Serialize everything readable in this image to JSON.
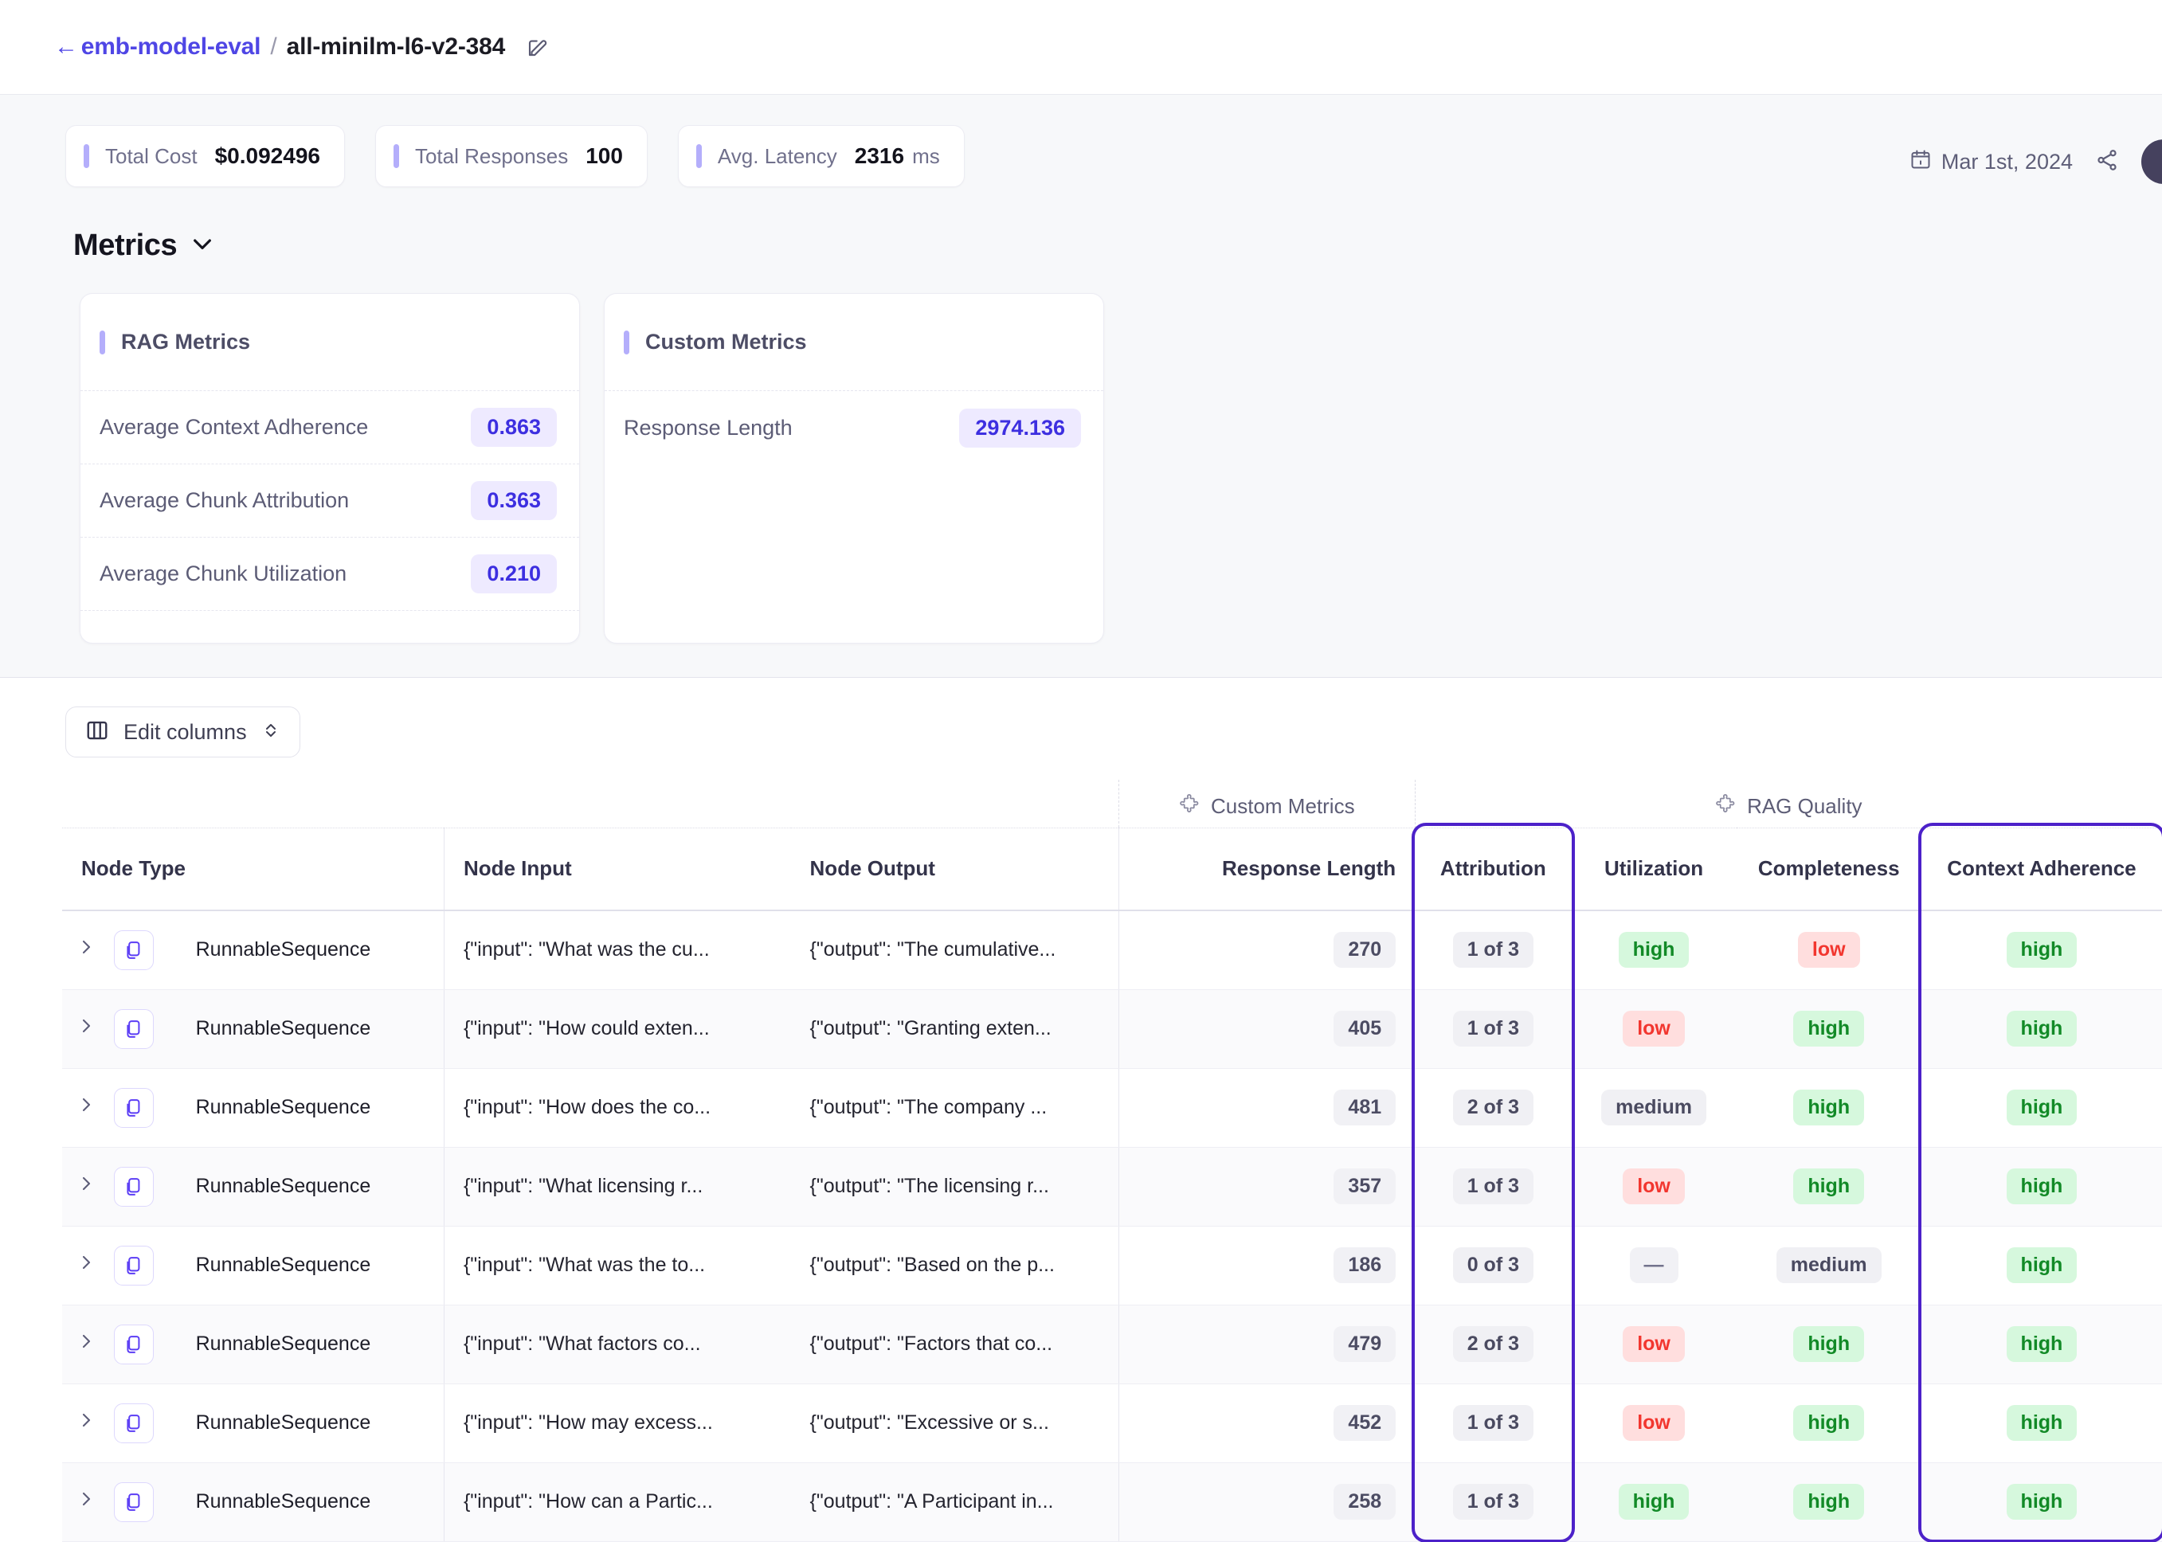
{
  "breadcrumb": {
    "back_arrow": "←",
    "parent": "emb-model-eval",
    "separator": "/",
    "current": "all-minilm-l6-v2-384",
    "edit_icon": "edit-icon"
  },
  "stats": [
    {
      "label": "Total Cost",
      "value": "$0.092496",
      "unit": ""
    },
    {
      "label": "Total Responses",
      "value": "100",
      "unit": ""
    },
    {
      "label": "Avg. Latency",
      "value": "2316",
      "unit": "ms"
    }
  ],
  "meta": {
    "date": "Mar 1st, 2024",
    "calendar_icon": "calendar-icon",
    "share_icon": "share-nodes-icon",
    "avatar": "user-avatar"
  },
  "metrics_section": {
    "title": "Metrics",
    "chevron": "chevron-down-icon",
    "cards": [
      {
        "title": "RAG Metrics",
        "rows": [
          {
            "label": "Average Context Adherence",
            "value": "0.863"
          },
          {
            "label": "Average Chunk Attribution",
            "value": "0.363"
          },
          {
            "label": "Average Chunk Utilization",
            "value": "0.210"
          }
        ]
      },
      {
        "title": "Custom Metrics",
        "rows": [
          {
            "label": "Response Length",
            "value": "2974.136"
          }
        ]
      }
    ]
  },
  "toolbar": {
    "edit_columns_label": "Edit columns",
    "columns_icon": "columns-icon",
    "sort_icon": "chevron-up-down-icon"
  },
  "table": {
    "groups": [
      {
        "label": "Custom Metrics",
        "icon": "puzzle-piece-icon"
      },
      {
        "label": "RAG Quality",
        "icon": "puzzle-piece-icon"
      }
    ],
    "columns": [
      "Node Type",
      "Node Input",
      "Node Output",
      "Response Length",
      "Attribution",
      "Utilization",
      "Completeness",
      "Context Adherence"
    ],
    "expand_icon": "chevron-right-icon",
    "node_icon": "copy-node-icon",
    "rows": [
      {
        "node_type": "RunnableSequence",
        "node_input": "{\"input\": \"What was the cu...",
        "node_output": "{\"output\": \"The cumulative...",
        "response_length": "270",
        "attribution": "1 of 3",
        "utilization": "high",
        "utilization_kind": "high",
        "completeness": "low",
        "completeness_kind": "low",
        "context_adherence": "high",
        "context_adherence_kind": "high"
      },
      {
        "node_type": "RunnableSequence",
        "node_input": "{\"input\": \"How could exten...",
        "node_output": "{\"output\": \"Granting exten...",
        "response_length": "405",
        "attribution": "1 of 3",
        "utilization": "low",
        "utilization_kind": "low",
        "completeness": "high",
        "completeness_kind": "high",
        "context_adherence": "high",
        "context_adherence_kind": "high"
      },
      {
        "node_type": "RunnableSequence",
        "node_input": "{\"input\": \"How does the co...",
        "node_output": "{\"output\": \"The company ...",
        "response_length": "481",
        "attribution": "2 of 3",
        "utilization": "medium",
        "utilization_kind": "medium",
        "completeness": "high",
        "completeness_kind": "high",
        "context_adherence": "high",
        "context_adherence_kind": "high"
      },
      {
        "node_type": "RunnableSequence",
        "node_input": "{\"input\": \"What licensing r...",
        "node_output": "{\"output\": \"The licensing r...",
        "response_length": "357",
        "attribution": "1 of 3",
        "utilization": "low",
        "utilization_kind": "low",
        "completeness": "high",
        "completeness_kind": "high",
        "context_adherence": "high",
        "context_adherence_kind": "high"
      },
      {
        "node_type": "RunnableSequence",
        "node_input": "{\"input\": \"What was the to...",
        "node_output": "{\"output\": \"Based on the p...",
        "response_length": "186",
        "attribution": "0 of 3",
        "utilization": "—",
        "utilization_kind": "dash",
        "completeness": "medium",
        "completeness_kind": "medium",
        "context_adherence": "high",
        "context_adherence_kind": "high"
      },
      {
        "node_type": "RunnableSequence",
        "node_input": "{\"input\": \"What factors co...",
        "node_output": "{\"output\": \"Factors that co...",
        "response_length": "479",
        "attribution": "2 of 3",
        "utilization": "low",
        "utilization_kind": "low",
        "completeness": "high",
        "completeness_kind": "high",
        "context_adherence": "high",
        "context_adherence_kind": "high"
      },
      {
        "node_type": "RunnableSequence",
        "node_input": "{\"input\": \"How may excess...",
        "node_output": "{\"output\": \"Excessive or s...",
        "response_length": "452",
        "attribution": "1 of 3",
        "utilization": "low",
        "utilization_kind": "low",
        "completeness": "high",
        "completeness_kind": "high",
        "context_adherence": "high",
        "context_adherence_kind": "high"
      },
      {
        "node_type": "RunnableSequence",
        "node_input": "{\"input\": \"How can a Partic...",
        "node_output": "{\"output\": \"A Participant in...",
        "response_length": "258",
        "attribution": "1 of 3",
        "utilization": "high",
        "utilization_kind": "high",
        "completeness": "high",
        "completeness_kind": "high",
        "context_adherence": "high",
        "context_adherence_kind": "high"
      }
    ]
  },
  "colors": {
    "accent": "#4f46e5",
    "highlight_outline": "#4c21c9",
    "tick": "#b4aefb",
    "pill_value": "#3d2fe0",
    "high": "#128a27",
    "low": "#f2362f"
  }
}
